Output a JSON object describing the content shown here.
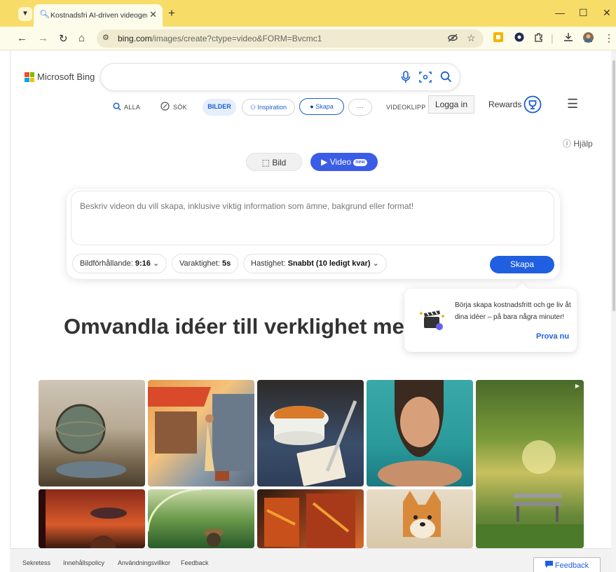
{
  "browser": {
    "tab_title": "Kostnadsfri AI-driven videogenerator",
    "url_domain": "bing.com",
    "url_path": "/images/create?ctype=video&FORM=Bvcmc1",
    "new_tab_symbol": "+",
    "icons": [
      "tab-search-icon",
      "back-icon",
      "forward-icon",
      "reload-icon",
      "home-icon",
      "site-info-icon",
      "eye-off-icon",
      "star-icon",
      "extensions-icon",
      "download-icon",
      "menu-dots-icon"
    ]
  },
  "header": {
    "logo_text": "Microsoft Bing",
    "logo_colors": [
      "#f25022",
      "#7fba00",
      "#00a4ef",
      "#ffb900"
    ],
    "login_label": "Logga in",
    "rewards_label": "Rewards"
  },
  "nav": {
    "all": "ALLA",
    "search": "SÖK",
    "images": "BILDER",
    "inspiration": "Inspiration",
    "create": "Skapa",
    "more": "···",
    "videoclips": "VIDEOKLIPP"
  },
  "help_label": "Hjälp",
  "modes": {
    "image": "Bild",
    "video": "Video",
    "new_badge": "new"
  },
  "prompt": {
    "placeholder": "Beskriv videon du vill skapa, inklusive viktig information som ämne, bakgrund eller format!"
  },
  "options": {
    "aspect_label": "Bildförhållande:",
    "aspect_value": "9:16",
    "duration_label": "Varaktighet:",
    "duration_value": "5s",
    "speed_label": "Hastighet:",
    "speed_value": "Snabbt (10 ledigt kvar)"
  },
  "create_button": "Skapa",
  "tooltip": {
    "text": "Börja skapa kostnadsfritt och ge liv åt dina idéer – på bara några minuter!",
    "cta": "Prova nu"
  },
  "headline": "Omvandla idéer till verklighet med",
  "footer": {
    "links": [
      "Sekretess",
      "Innehållspolicy",
      "Användningsvillkor",
      "Feedback"
    ],
    "feedback_button": "Feedback"
  },
  "colors": {
    "accent": "#1f5fe0",
    "chrome": "#f8dc68"
  }
}
